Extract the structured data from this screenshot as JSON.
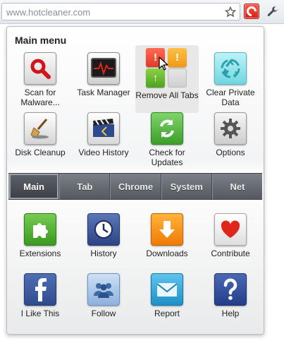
{
  "browser": {
    "url": "www.hotcleaner.com"
  },
  "popup": {
    "title": "Main menu",
    "top_tiles": [
      {
        "id": "scan",
        "label": "Scan for Malware...",
        "icon": "magnifier-icon"
      },
      {
        "id": "task",
        "label": "Task Manager",
        "icon": "monitor-pulse-icon"
      },
      {
        "id": "clear",
        "label": "Clear Private Data",
        "icon": "recycle-icon"
      },
      {
        "id": "disk",
        "label": "Disk Cleanup",
        "icon": "broom-icon"
      },
      {
        "id": "video",
        "label": "Video History",
        "icon": "clapperboard-icon"
      },
      {
        "id": "updates",
        "label": "Check for Updates",
        "icon": "refresh-arrows-icon"
      },
      {
        "id": "options",
        "label": "Options",
        "icon": "gear-icon"
      }
    ],
    "remove_tabs": {
      "label": "Remove All Tabs",
      "mini_icons": [
        "!",
        "!",
        "↑",
        ""
      ]
    },
    "tabs": [
      {
        "label": "Main",
        "active": true
      },
      {
        "label": "Tab",
        "active": false
      },
      {
        "label": "Chrome",
        "active": false
      },
      {
        "label": "System",
        "active": false
      },
      {
        "label": "Net",
        "active": false
      }
    ],
    "bottom_tiles": [
      {
        "id": "extensions",
        "label": "Extensions",
        "icon": "puzzle-icon"
      },
      {
        "id": "history",
        "label": "History",
        "icon": "clock-icon"
      },
      {
        "id": "downloads",
        "label": "Downloads",
        "icon": "download-arrow-icon"
      },
      {
        "id": "contribute",
        "label": "Contribute",
        "icon": "heart-icon"
      },
      {
        "id": "like",
        "label": "I Like This",
        "icon": "facebook-icon"
      },
      {
        "id": "follow",
        "label": "Follow",
        "icon": "people-icon"
      },
      {
        "id": "report",
        "label": "Report",
        "icon": "envelope-icon"
      },
      {
        "id": "help",
        "label": "Help",
        "icon": "question-icon"
      }
    ]
  },
  "colors": {
    "accent_red": "#d21c12",
    "tabbar_dark": "#55595f"
  }
}
